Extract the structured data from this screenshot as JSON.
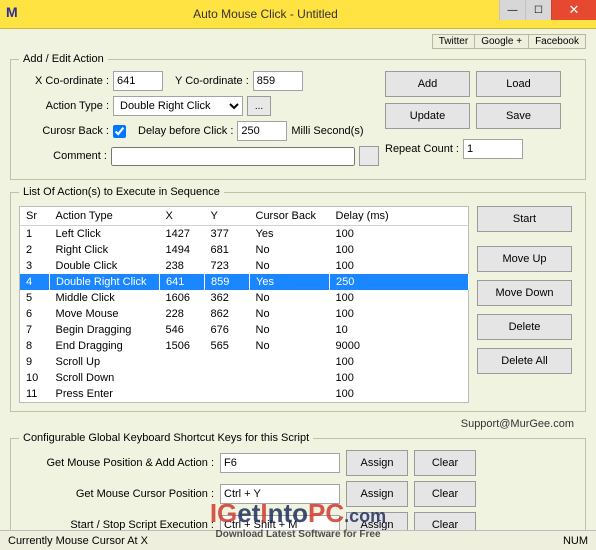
{
  "window": {
    "icon_letter": "M",
    "title": "Auto Mouse Click - Untitled"
  },
  "top_links": {
    "twitter": "Twitter",
    "google": "Google +",
    "facebook": "Facebook"
  },
  "addedit": {
    "legend": "Add / Edit Action",
    "x_label": "X Co-ordinate :",
    "x_value": "641",
    "y_label": "Y Co-ordinate :",
    "y_value": "859",
    "action_type_label": "Action Type :",
    "action_type_value": "Double Right Click",
    "ellipsis": "...",
    "cursor_back_label": "Curosr Back :",
    "cursor_back_checked": true,
    "delay_label": "Delay before Click :",
    "delay_value": "250",
    "delay_units": "Milli Second(s)",
    "comment_label": "Comment :",
    "comment_value": "",
    "repeat_label": "Repeat Count :",
    "repeat_value": "1",
    "btn_add": "Add",
    "btn_load": "Load",
    "btn_update": "Update",
    "btn_save": "Save"
  },
  "list": {
    "legend": "List Of Action(s) to Execute in Sequence",
    "headers": {
      "sr": "Sr",
      "action": "Action Type",
      "x": "X",
      "y": "Y",
      "cursor": "Cursor Back",
      "delay": "Delay (ms)"
    },
    "rows": [
      {
        "sr": "1",
        "action": "Left Click",
        "x": "1427",
        "y": "377",
        "cursor": "Yes",
        "delay": "100",
        "selected": false
      },
      {
        "sr": "2",
        "action": "Right Click",
        "x": "1494",
        "y": "681",
        "cursor": "No",
        "delay": "100",
        "selected": false
      },
      {
        "sr": "3",
        "action": "Double Click",
        "x": "238",
        "y": "723",
        "cursor": "No",
        "delay": "100",
        "selected": false
      },
      {
        "sr": "4",
        "action": "Double Right Click",
        "x": "641",
        "y": "859",
        "cursor": "Yes",
        "delay": "250",
        "selected": true
      },
      {
        "sr": "5",
        "action": "Middle Click",
        "x": "1606",
        "y": "362",
        "cursor": "No",
        "delay": "100",
        "selected": false
      },
      {
        "sr": "6",
        "action": "Move Mouse",
        "x": "228",
        "y": "862",
        "cursor": "No",
        "delay": "100",
        "selected": false
      },
      {
        "sr": "7",
        "action": "Begin Dragging",
        "x": "546",
        "y": "676",
        "cursor": "No",
        "delay": "10",
        "selected": false
      },
      {
        "sr": "8",
        "action": "End Dragging",
        "x": "1506",
        "y": "565",
        "cursor": "No",
        "delay": "9000",
        "selected": false
      },
      {
        "sr": "9",
        "action": "Scroll Up",
        "x": "",
        "y": "",
        "cursor": "",
        "delay": "100",
        "selected": false
      },
      {
        "sr": "10",
        "action": "Scroll Down",
        "x": "",
        "y": "",
        "cursor": "",
        "delay": "100",
        "selected": false
      },
      {
        "sr": "11",
        "action": "Press Enter",
        "x": "",
        "y": "",
        "cursor": "",
        "delay": "100",
        "selected": false
      }
    ],
    "btn_start": "Start",
    "btn_moveup": "Move Up",
    "btn_movedown": "Move Down",
    "btn_delete": "Delete",
    "btn_deleteall": "Delete All"
  },
  "support_text": "Support@MurGee.com",
  "shortcuts": {
    "legend": "Configurable Global Keyboard Shortcut Keys for this Script",
    "rows": [
      {
        "label": "Get Mouse Position & Add Action :",
        "value": "F6"
      },
      {
        "label": "Get Mouse Cursor Position :",
        "value": "Ctrl + Y"
      },
      {
        "label": "Start / Stop Script Execution :",
        "value": "Ctrl + Shift + M"
      }
    ],
    "btn_assign": "Assign",
    "btn_clear": "Clear"
  },
  "status": {
    "left": "Currently Mouse Cursor At X",
    "right": "NUM"
  },
  "watermark": {
    "brand_1": "IG",
    "brand_2": "et",
    "brand_3": "I",
    "brand_4": "nto",
    "brand_5": "PC",
    "brand_6": ".com",
    "tag": "Download Latest Software for Free"
  }
}
